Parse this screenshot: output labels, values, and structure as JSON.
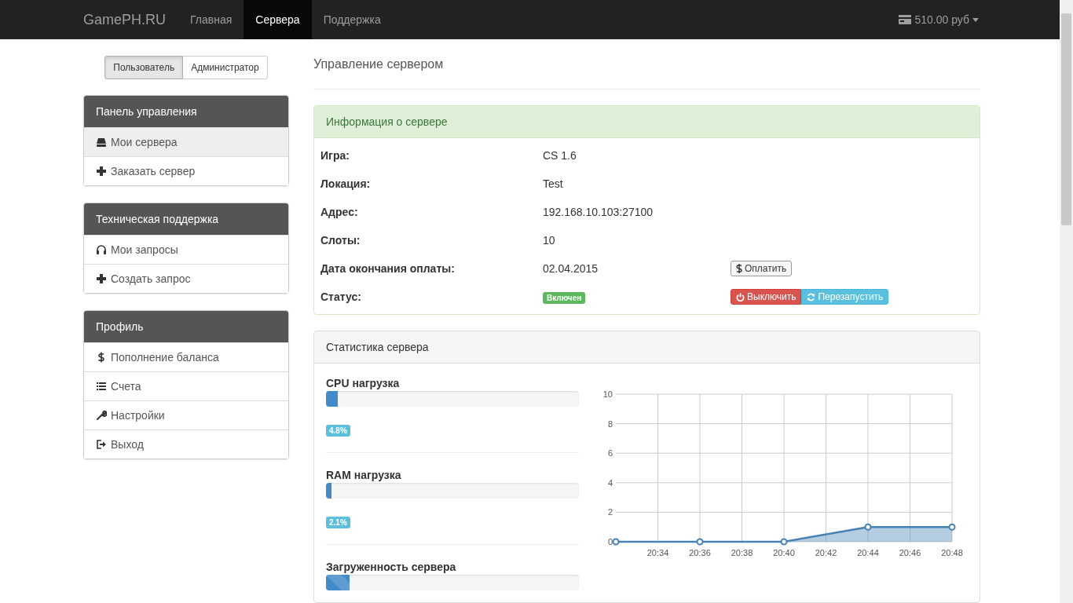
{
  "navbar": {
    "brand": "GamePH.RU",
    "links": [
      {
        "label": "Главная",
        "selected": false
      },
      {
        "label": "Сервера",
        "selected": true
      },
      {
        "label": "Поддержка",
        "selected": false
      }
    ],
    "balance": "510.00 руб"
  },
  "role_switch": [
    {
      "label": "Пользователь",
      "selected": true
    },
    {
      "label": "Администратор",
      "selected": false
    }
  ],
  "sidebar": [
    {
      "title": "Панель управления",
      "items": [
        {
          "kind": "drive",
          "label": "Мои сервера",
          "selected": true
        },
        {
          "kind": "plus",
          "label": "Заказать сервер",
          "selected": false
        }
      ]
    },
    {
      "title": "Техническая поддержка",
      "items": [
        {
          "kind": "headphones",
          "label": "Мои запросы",
          "selected": false
        },
        {
          "kind": "plus",
          "label": "Создать запрос",
          "selected": false
        }
      ]
    },
    {
      "title": "Профиль",
      "items": [
        {
          "kind": "dollar",
          "label": "Пополнение баланса",
          "selected": false
        },
        {
          "kind": "list",
          "label": "Счета",
          "selected": false
        },
        {
          "kind": "wrench",
          "label": "Настройки",
          "selected": false
        },
        {
          "kind": "logout",
          "label": "Выход",
          "selected": false
        }
      ]
    }
  ],
  "page_title": "Управление сервером",
  "info_panel": {
    "title": "Информация о сервере",
    "rows": [
      {
        "label": "Игра:",
        "value": "CS 1.6"
      },
      {
        "label": "Локация:",
        "value": "Test"
      },
      {
        "label": "Адрес:",
        "value": "192.168.10.103:27100"
      },
      {
        "label": "Слоты:",
        "value": "10"
      },
      {
        "label": "Дата окончания оплаты:",
        "value": "02.04.2015",
        "actions": [
          {
            "kind": "pay",
            "label": "Оплатить"
          }
        ]
      },
      {
        "label": "Статус:",
        "status": "Включен",
        "actions": [
          {
            "kind": "stop",
            "label": "Выключить"
          },
          {
            "kind": "restart",
            "label": "Перезапустить"
          }
        ]
      }
    ]
  },
  "stats_panel": {
    "title": "Статистика сервера",
    "meters": [
      {
        "label": "CPU нагрузка",
        "level": 0.048,
        "reading": "4.8%",
        "striped": false
      },
      {
        "label": "RAM нагрузка",
        "level": 0.021,
        "reading": "2.1%",
        "striped": false
      },
      {
        "label": "Загруженность сервера",
        "level": 0.094,
        "striped": true
      }
    ],
    "chart_data": {
      "type": "area",
      "categories": [
        null,
        "20:34",
        "20:36",
        "20:38",
        "20:40",
        "20:42",
        "20:44",
        "20:46",
        "20:48"
      ],
      "series": [
        {
          "color": "#4682b4",
          "values": [
            0,
            null,
            0,
            null,
            0,
            null,
            1,
            null,
            1
          ]
        }
      ],
      "ylim": [
        0,
        10
      ],
      "yticks": [
        0,
        2,
        4,
        6,
        8,
        10
      ],
      "grid": true
    }
  }
}
